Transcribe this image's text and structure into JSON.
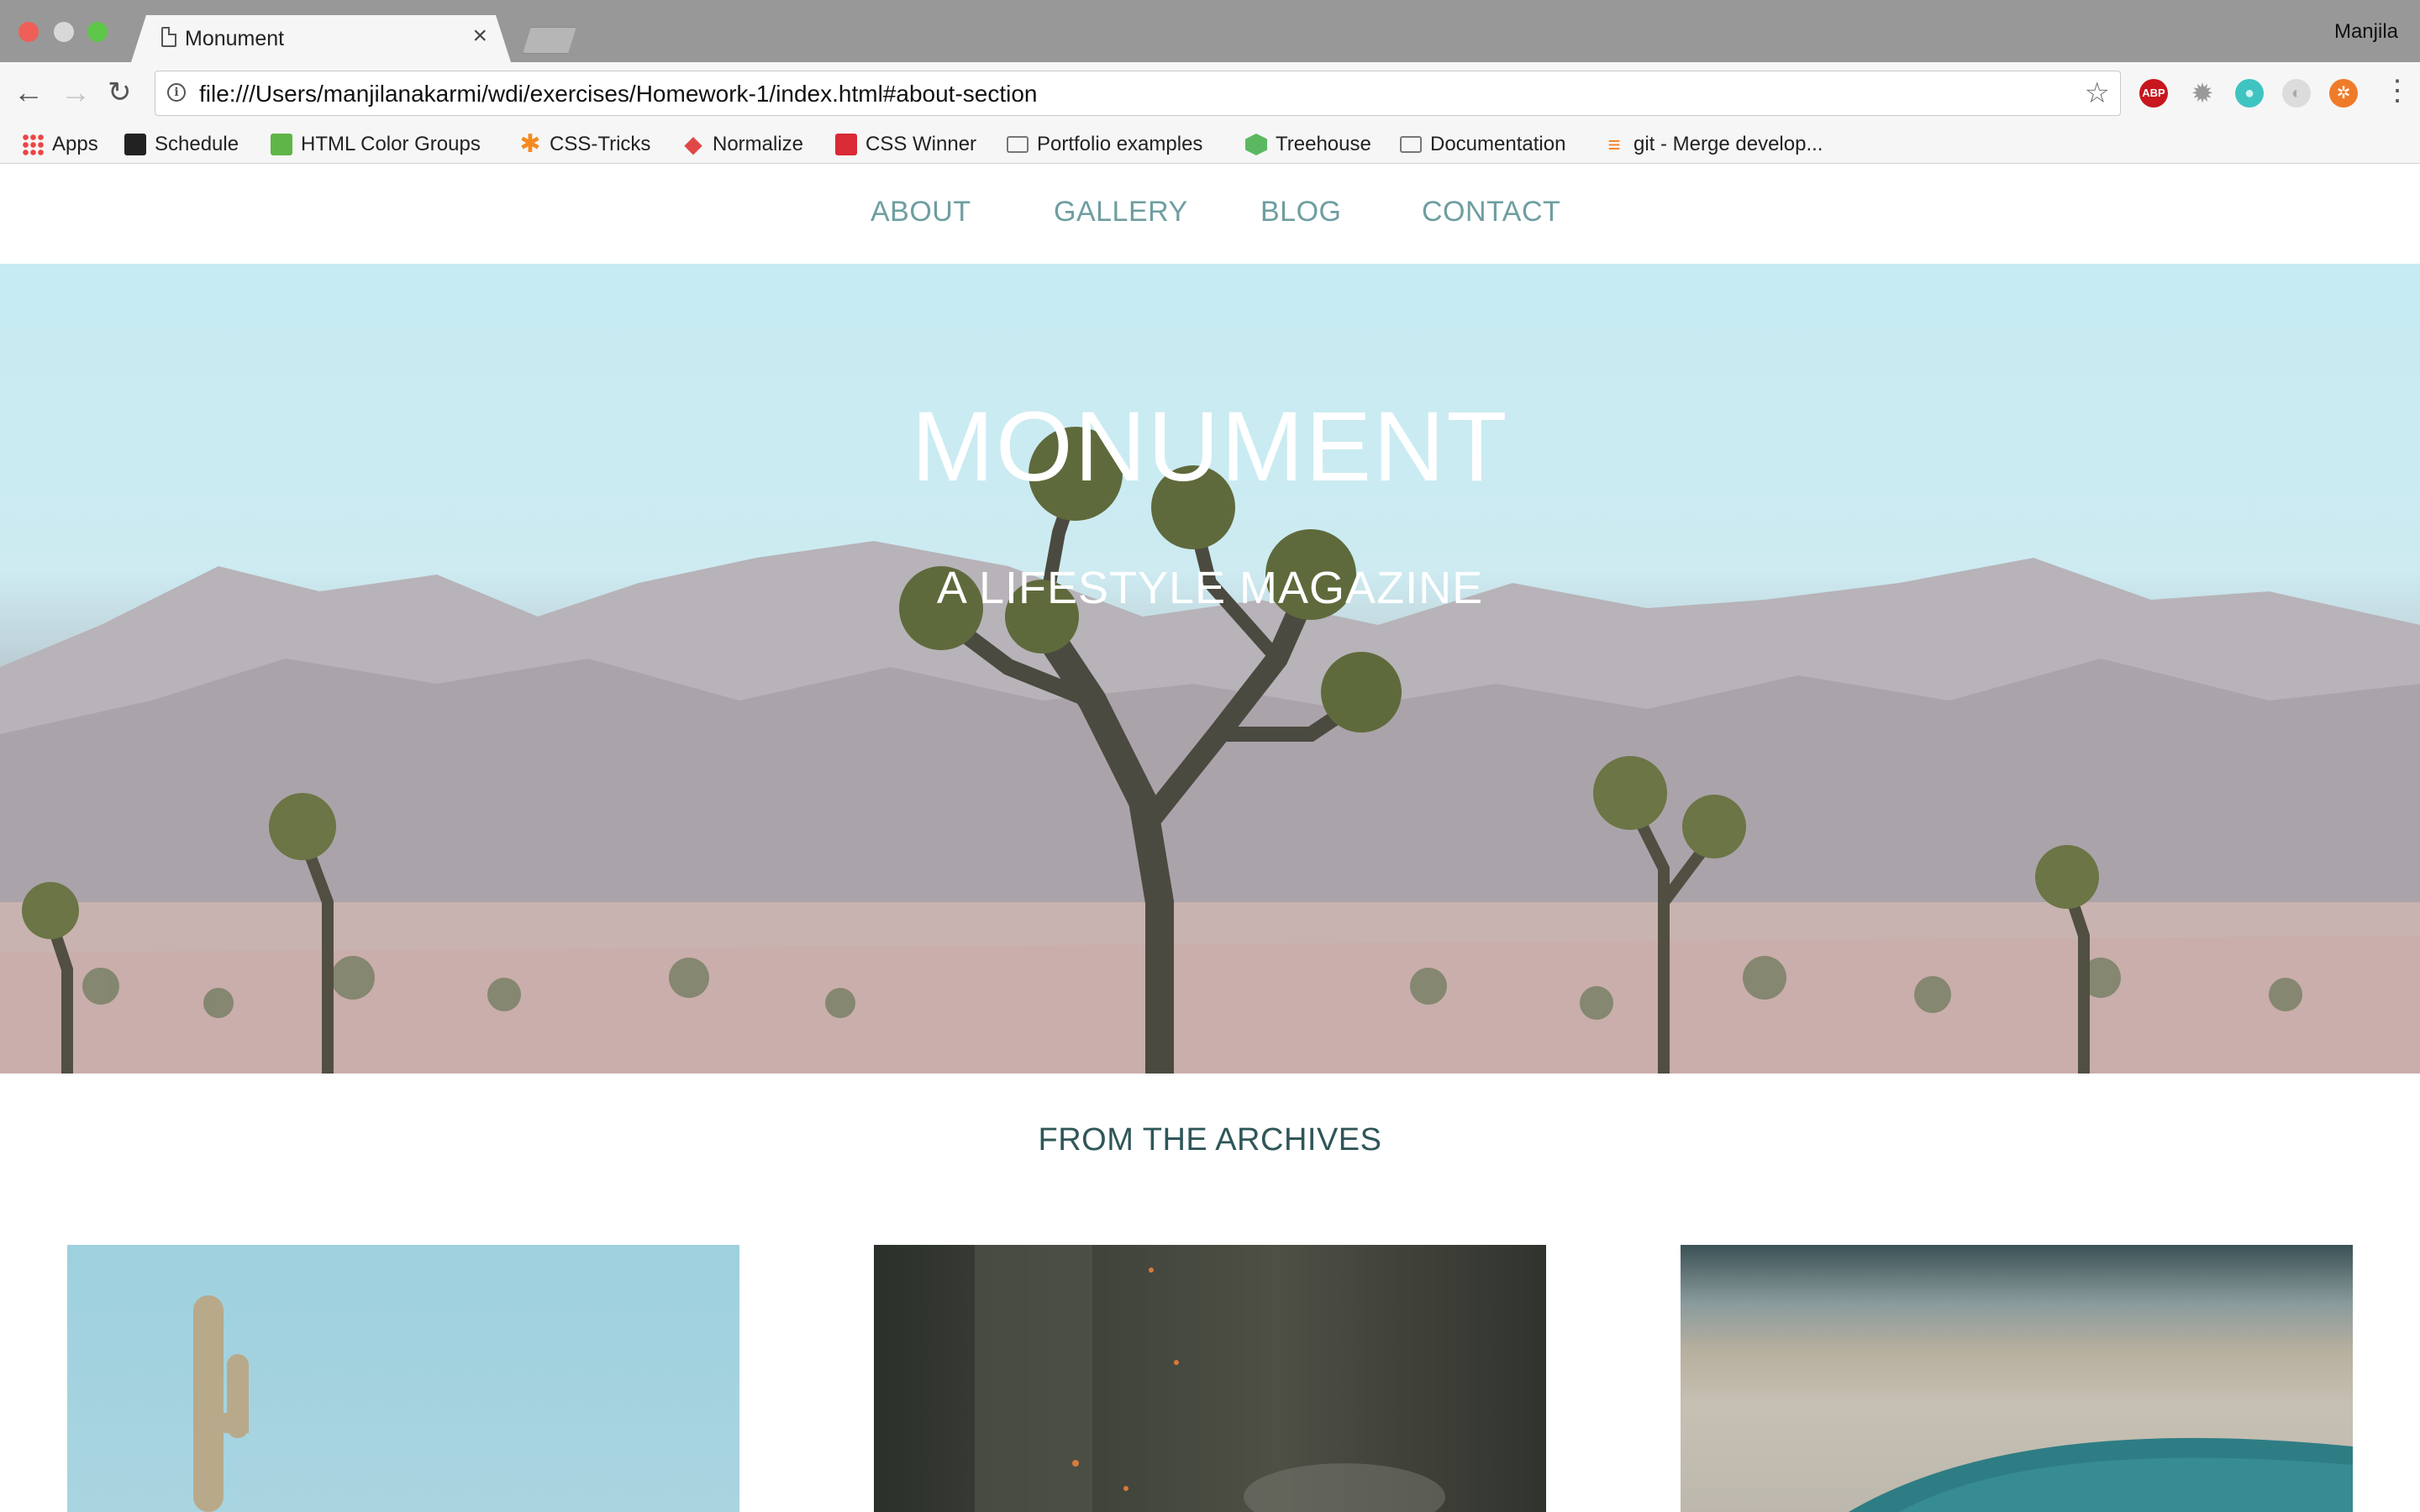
{
  "browser": {
    "tab_title": "Monument",
    "tab_close": "×",
    "profile_name": "Manjila",
    "url": "file:///Users/manjilanakarmi/wdi/exercises/Homework-1/index.html#about-section",
    "bookmarks": [
      {
        "label": "Apps",
        "icon": "apps-grid-icon"
      },
      {
        "label": "Schedule",
        "icon": "github-icon"
      },
      {
        "label": "HTML Color Groups",
        "icon": "color-groups-icon"
      },
      {
        "label": "CSS-Tricks",
        "icon": "css-tricks-icon"
      },
      {
        "label": "Normalize",
        "icon": "normalize-icon"
      },
      {
        "label": "CSS Winner",
        "icon": "css-winner-icon"
      },
      {
        "label": "Portfolio examples",
        "icon": "folder-icon"
      },
      {
        "label": "Treehouse",
        "icon": "treehouse-icon"
      },
      {
        "label": "Documentation",
        "icon": "folder-icon"
      },
      {
        "label": "git - Merge develop...",
        "icon": "stackoverflow-icon"
      }
    ],
    "extensions": {
      "abp_label": "ABP"
    }
  },
  "site": {
    "nav": [
      "ABOUT",
      "GALLERY",
      "BLOG",
      "CONTACT"
    ],
    "hero_title": "MONUMENT",
    "hero_subtitle": "A LIFESTYLE MAGAZINE",
    "archives_title": "FROM THE ARCHIVES"
  },
  "colors": {
    "nav_link": "#6e9ea0",
    "archives_title": "#2f5658",
    "sky": "#c6ebf3",
    "titlebar": "#989898"
  }
}
